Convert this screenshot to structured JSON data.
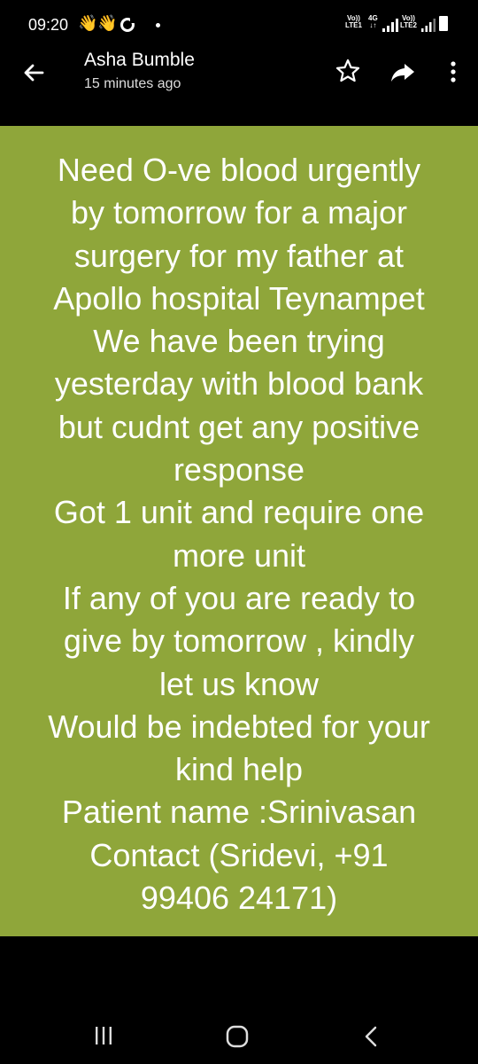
{
  "status_bar": {
    "time": "09:20",
    "emoji_1": "👋",
    "emoji_2": "👋",
    "net1_top": "Vo))",
    "net1_bottom": "LTE1",
    "net_type": "4G",
    "net2_top": "Vo))",
    "net2_bottom": "LTE2"
  },
  "header": {
    "sender_name": "Asha Bumble",
    "timestamp": "15 minutes ago"
  },
  "message": {
    "text": "Need O-ve blood urgently\nby tomorrow for a major\nsurgery for my father at\nApollo hospital Teynampet\nWe have been trying\nyesterday with blood bank\nbut cudnt get any positive\nresponse\nGot 1 unit and require one\nmore unit\nIf any of you are ready to\ngive by tomorrow , kindly\nlet us know\nWould be indebted for your\nkind help\nPatient name :Srinivasan\nContact (Sridevi, +91\n99406 24171)",
    "background_color": "#8fa63a"
  },
  "icons": {
    "back": "arrow-left-icon",
    "star": "star-outline-icon",
    "share": "share-arrow-icon",
    "more": "more-vertical-icon",
    "recent_apps": "recent-apps-icon",
    "home": "home-icon",
    "nav_back": "chevron-left-icon"
  }
}
